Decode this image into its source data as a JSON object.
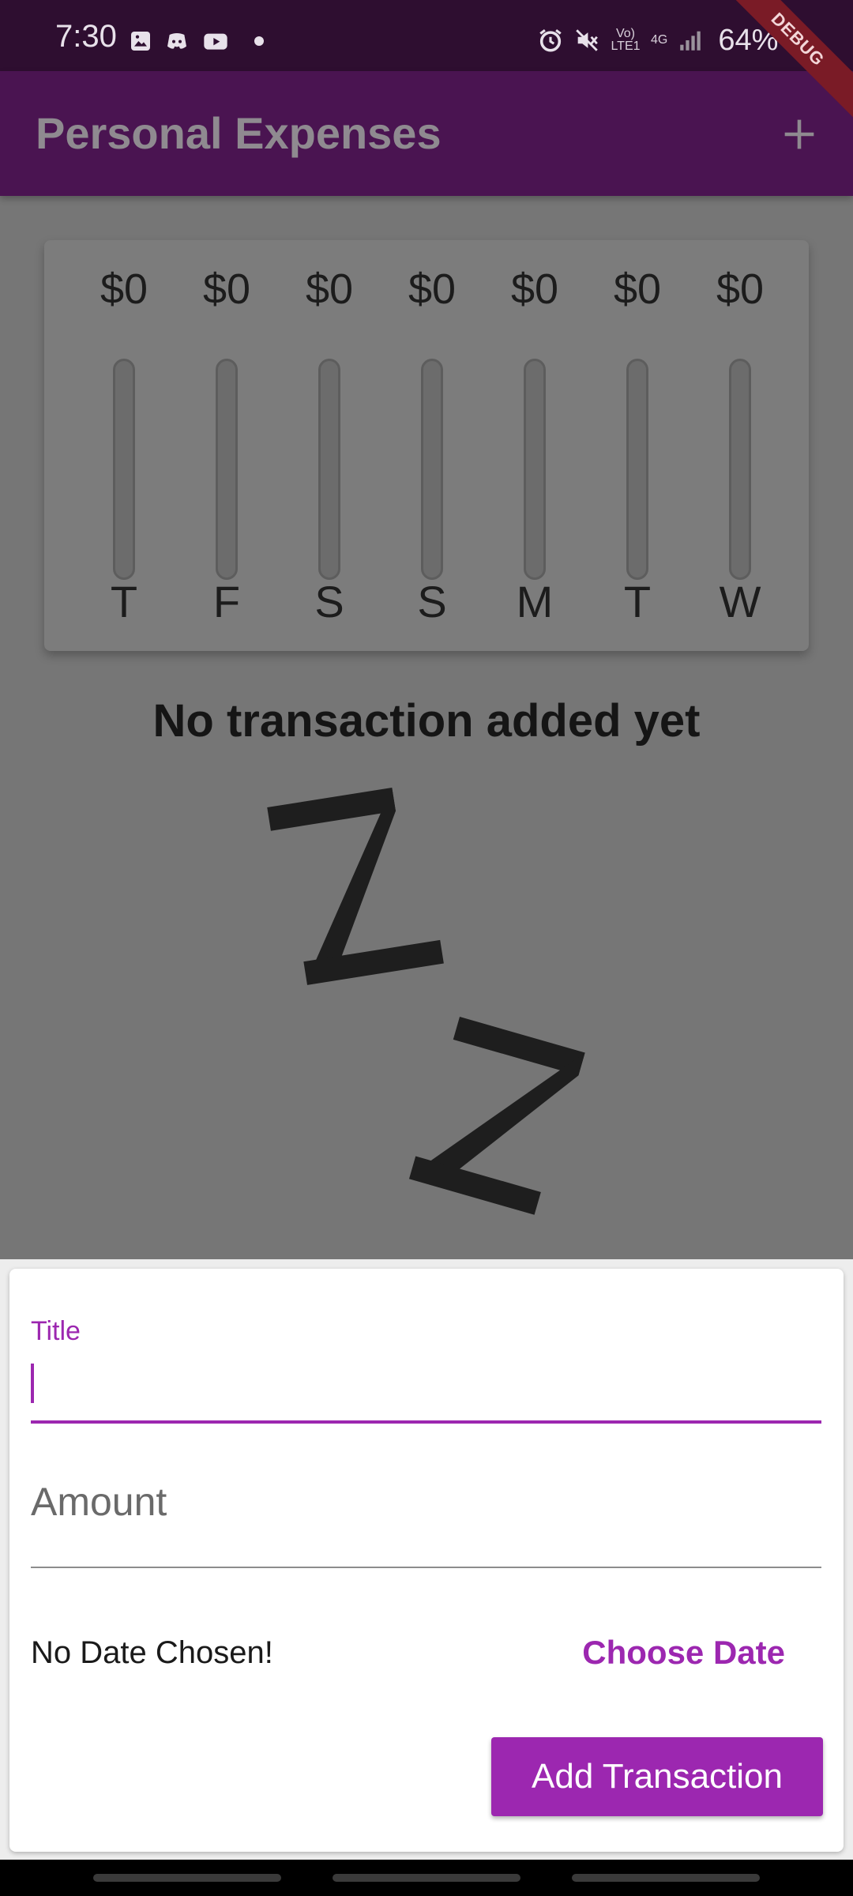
{
  "status_bar": {
    "time": "7:30",
    "network": "Vo) LTE1",
    "network_type": "4G",
    "battery": "64%",
    "icons": [
      "gallery-icon",
      "discord-icon",
      "youtube-icon",
      "alarm-icon",
      "mute-icon",
      "signal-icon"
    ]
  },
  "debug_banner": "DEBUG",
  "app_bar": {
    "title": "Personal Expenses",
    "add_icon": "plus-icon"
  },
  "chart_data": {
    "type": "bar",
    "categories": [
      "T",
      "F",
      "S",
      "S",
      "M",
      "T",
      "W"
    ],
    "labels": [
      "$0",
      "$0",
      "$0",
      "$0",
      "$0",
      "$0",
      "$0"
    ],
    "values": [
      0,
      0,
      0,
      0,
      0,
      0,
      0
    ],
    "fill_fraction": [
      0,
      0,
      0,
      0,
      0,
      0,
      0
    ],
    "title": "",
    "xlabel": "",
    "ylabel": ""
  },
  "empty_state": {
    "title": "No transaction added yet",
    "illustration": "zz-sleep-icon"
  },
  "new_transaction": {
    "title_label": "Title",
    "title_value": "",
    "amount_placeholder": "Amount",
    "amount_value": "",
    "date_text": "No Date Chosen!",
    "choose_date_label": "Choose Date",
    "submit_label": "Add Transaction"
  },
  "colors": {
    "primary": "#9c27b0",
    "app_bar": "#4a1451",
    "status_bar": "#2e0e30",
    "scrim": "#767676"
  }
}
